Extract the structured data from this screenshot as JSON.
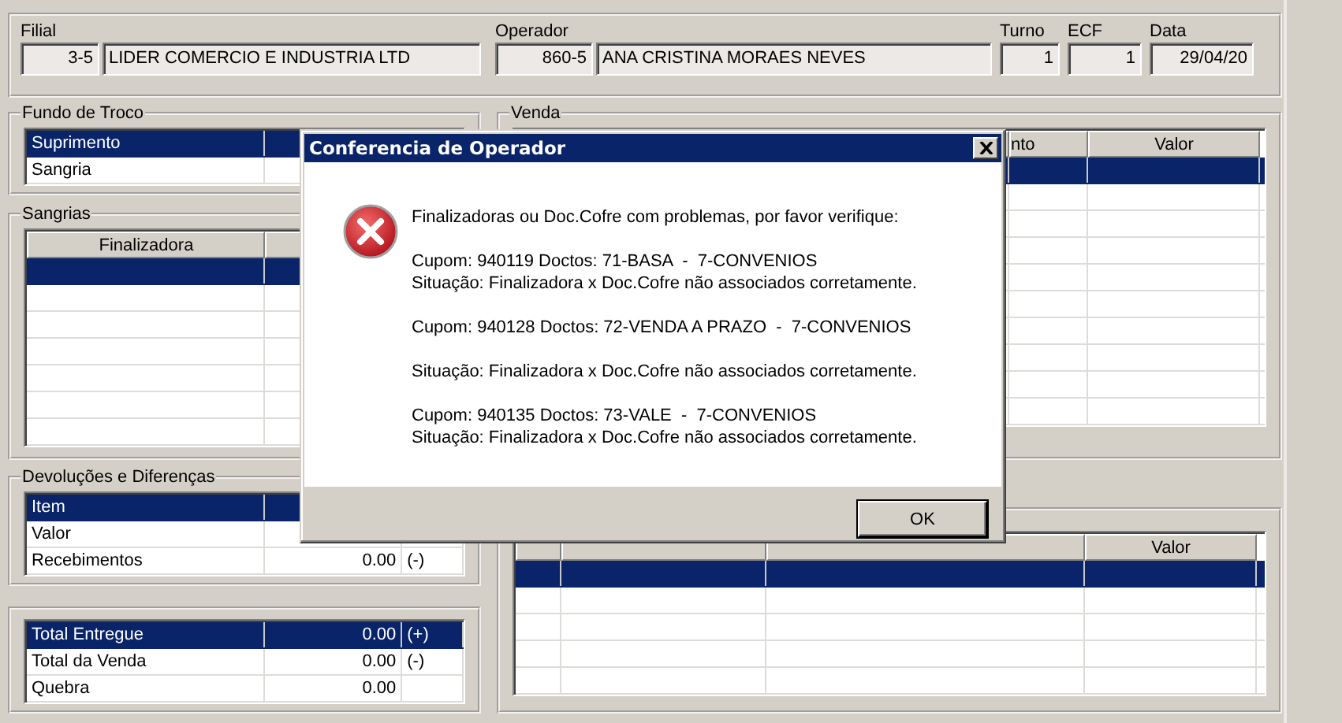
{
  "header": {
    "filial_label": "Filial",
    "filial_code": "3-5",
    "filial_name": "LIDER COMERCIO E INDUSTRIA LTD",
    "operador_label": "Operador",
    "operador_code": "860-5",
    "operador_name": "ANA CRISTINA MORAES NEVES",
    "turno_label": "Turno",
    "turno": "1",
    "ecf_label": "ECF",
    "ecf": "1",
    "data_label": "Data",
    "data": "29/04/20"
  },
  "fundo_de_troco": {
    "title": "Fundo de Troco",
    "rows": [
      {
        "label": "Suprimento",
        "selected": true
      },
      {
        "label": "Sangria",
        "selected": false
      }
    ]
  },
  "sangrias": {
    "title": "Sangrias",
    "column_1": "Finalizadora",
    "rows": [
      {
        "selected": true
      },
      {
        "selected": false
      },
      {
        "selected": false
      },
      {
        "selected": false
      },
      {
        "selected": false
      },
      {
        "selected": false
      },
      {
        "selected": false
      }
    ]
  },
  "devolucoes": {
    "title": "Devoluções e Diferenças",
    "rows": [
      {
        "label": "Item",
        "selected": true
      },
      {
        "label": "Valor",
        "selected": false
      },
      {
        "label": "Recebimentos",
        "value": "0.00",
        "sign": "(-)",
        "selected": false
      }
    ]
  },
  "totais": {
    "rows": [
      {
        "label": "Total Entregue",
        "value": "0.00",
        "sign": "(+)",
        "selected": true
      },
      {
        "label": "Total da Venda",
        "value": "0.00",
        "sign": "(-)",
        "selected": false
      },
      {
        "label": "Quebra",
        "value": "0.00",
        "selected": false
      }
    ]
  },
  "venda": {
    "title": "Venda",
    "column_3": "nto",
    "column_4": "Valor",
    "rows": [
      {
        "selected": true
      },
      {
        "selected": false
      },
      {
        "selected": false
      },
      {
        "selected": false
      },
      {
        "selected": false
      },
      {
        "selected": false
      },
      {
        "selected": false
      },
      {
        "selected": false
      },
      {
        "selected": false
      },
      {
        "selected": false
      }
    ]
  },
  "lower_right": {
    "column_4": "Valor",
    "rows": [
      {
        "selected": true
      },
      {
        "selected": false
      },
      {
        "selected": false
      },
      {
        "selected": false
      },
      {
        "selected": false
      }
    ]
  },
  "dialog": {
    "title": "Conferencia de Operador",
    "paragraphs": [
      [
        "Finalizadoras ou Doc.Cofre com problemas, por favor verifique:"
      ],
      [
        "Cupom: 940119 Doctos: 71-BASA  -  7-CONVENIOS",
        "Situação: Finalizadora x Doc.Cofre não associados corretamente."
      ],
      [
        "Cupom: 940128 Doctos: 72-VENDA A PRAZO  -  7-CONVENIOS"
      ],
      [
        "Situação: Finalizadora x Doc.Cofre não associados corretamente."
      ],
      [
        "Cupom: 940135 Doctos: 73-VALE  -  7-CONVENIOS",
        "Situação: Finalizadora x Doc.Cofre não associados corretamente."
      ]
    ],
    "ok_button": "OK"
  }
}
